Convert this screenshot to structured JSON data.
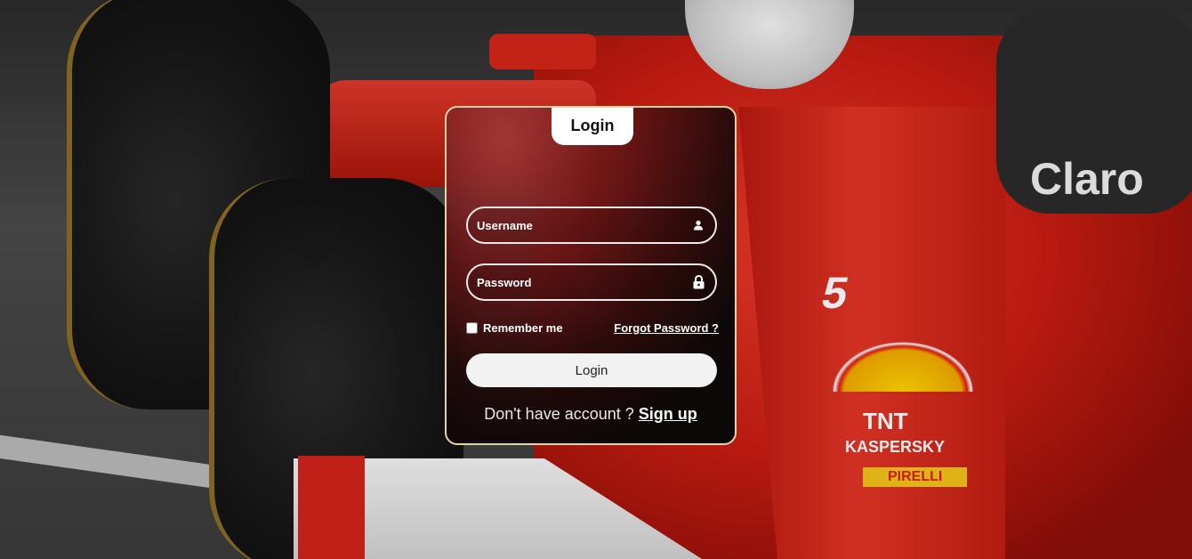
{
  "login": {
    "title": "Login",
    "username": {
      "placeholder": "Username",
      "value": "",
      "icon": "user-icon"
    },
    "password": {
      "placeholder": "Password",
      "value": "",
      "icon": "lock-icon"
    },
    "remember_label": "Remember me",
    "remember_checked": false,
    "forgot_label": "Forgot Password ?",
    "submit_label": "Login",
    "signup_prompt": "Don't have account ?",
    "signup_link": "Sign up"
  },
  "background": {
    "number": "5",
    "sponsors": [
      "Claro",
      "TNT",
      "KASPERSKY",
      "PIRELLI"
    ]
  },
  "colors": {
    "card_border": "#e6d3a3",
    "button_bg": "#f2f2f2",
    "text": "#ffffff"
  }
}
